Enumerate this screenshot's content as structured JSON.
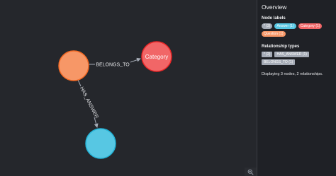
{
  "overview": {
    "title": "Overview",
    "node_labels_heading": "Node labels",
    "node_labels": [
      {
        "label": "* (3)",
        "color": "#a5abb6"
      },
      {
        "label": "Answer (1)",
        "color": "#57c7e3"
      },
      {
        "label": "Category (1)",
        "color": "#f16667"
      },
      {
        "label": "Question (1)",
        "color": "#f79767"
      }
    ],
    "relationship_types_heading": "Relationship types",
    "relationship_types": [
      {
        "label": "* (2)"
      },
      {
        "label": "HAS_ANSWER (1)"
      },
      {
        "label": "BELONGS_TO (1)"
      }
    ],
    "status": "Displaying 3 nodes, 2 relationships."
  },
  "graph": {
    "nodes": [
      {
        "id": "question",
        "caption": "",
        "color": "#f79767",
        "border": "#f36924"
      },
      {
        "id": "category",
        "caption": "Category",
        "color": "#f16667",
        "border": "#eb2728"
      },
      {
        "id": "answer",
        "caption": "",
        "color": "#57c7e3",
        "border": "#23b3d7"
      }
    ],
    "relationships": [
      {
        "from": "question",
        "to": "category",
        "type": "BELONGS_TO"
      },
      {
        "from": "question",
        "to": "answer",
        "type": "HAS_ANSWER"
      }
    ]
  },
  "icons": {
    "zoom": "zoom-in-icon"
  },
  "colors": {
    "edge": "#a5abb6",
    "canvas": "#25272c",
    "sidebar": "#1f2126"
  }
}
